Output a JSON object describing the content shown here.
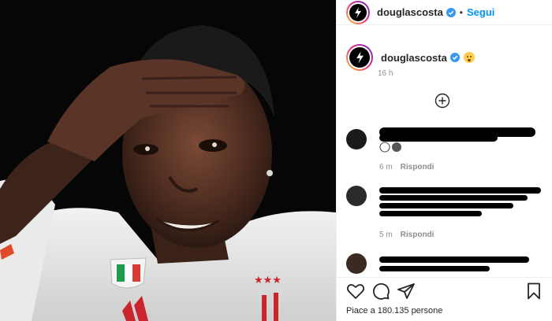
{
  "header": {
    "username": "douglascosta",
    "separator": "•",
    "follow_label": "Segui"
  },
  "caption": {
    "username": "douglascosta",
    "time": "16 h"
  },
  "comments": [
    {
      "time": "6 m",
      "reply_label": "Rispondi"
    },
    {
      "time": "5 m",
      "reply_label": "Rispondi"
    }
  ],
  "likes": {
    "text": "Piace a 180.135 persone"
  },
  "colors": {
    "accent": "#0095f6",
    "verified": "#3897f0",
    "text": "#262626",
    "muted": "#8e8e8e"
  },
  "icons": [
    "lightning-logo-icon",
    "verified-badge-icon",
    "add-comment-icon",
    "heart-icon",
    "comment-icon",
    "share-icon",
    "bookmark-icon"
  ]
}
